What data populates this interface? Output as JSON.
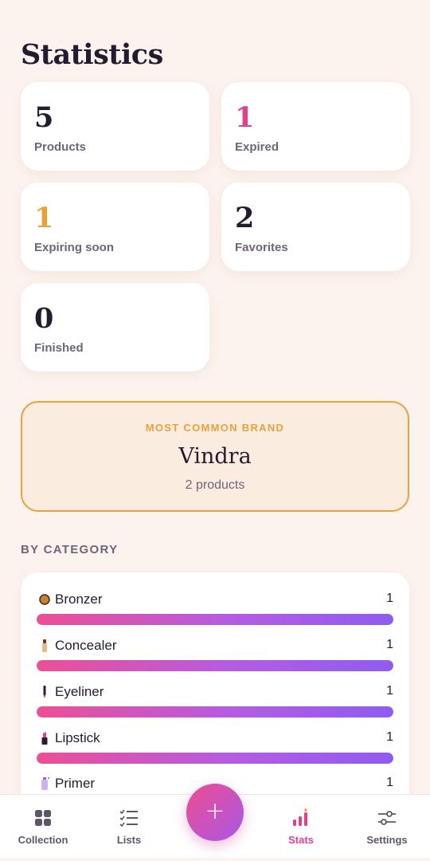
{
  "page": {
    "title": "Statistics"
  },
  "stats": [
    {
      "value": "5",
      "label": "Products",
      "color": "#231b2e"
    },
    {
      "value": "1",
      "label": "Expired",
      "color": "#e0418a"
    },
    {
      "value": "1",
      "label": "Expiring soon",
      "color": "#e9a23b"
    },
    {
      "value": "2",
      "label": "Favorites",
      "color": "#231b2e"
    },
    {
      "value": "0",
      "label": "Finished",
      "color": "#231b2e"
    }
  ],
  "brand": {
    "kicker": "MOST COMMON BRAND",
    "name": "Vindra",
    "count_text": "2 products"
  },
  "categories": {
    "title": "BY CATEGORY",
    "items": [
      {
        "name": "Bronzer",
        "count": "1",
        "fraction": 1.0,
        "icon": "bronzer-icon"
      },
      {
        "name": "Concealer",
        "count": "1",
        "fraction": 1.0,
        "icon": "concealer-icon"
      },
      {
        "name": "Eyeliner",
        "count": "1",
        "fraction": 1.0,
        "icon": "eyeliner-icon"
      },
      {
        "name": "Lipstick",
        "count": "1",
        "fraction": 1.0,
        "icon": "lipstick-icon"
      },
      {
        "name": "Primer",
        "count": "1",
        "fraction": 1.0,
        "icon": "primer-icon"
      }
    ]
  },
  "nav": {
    "items": [
      {
        "label": "Collection",
        "icon": "grid-icon",
        "active": false
      },
      {
        "label": "Lists",
        "icon": "checklist-icon",
        "active": false
      },
      {
        "label": "Stats",
        "icon": "bar-chart-icon",
        "active": true
      },
      {
        "label": "Settings",
        "icon": "sliders-icon",
        "active": false
      }
    ],
    "fab_symbol": "+"
  },
  "colors": {
    "accent_pink": "#e0418a",
    "accent_orange": "#e9a23b",
    "background": "#fdf3ee",
    "gradient_start": "#ec4f95",
    "gradient_end": "#8f5cf0"
  }
}
